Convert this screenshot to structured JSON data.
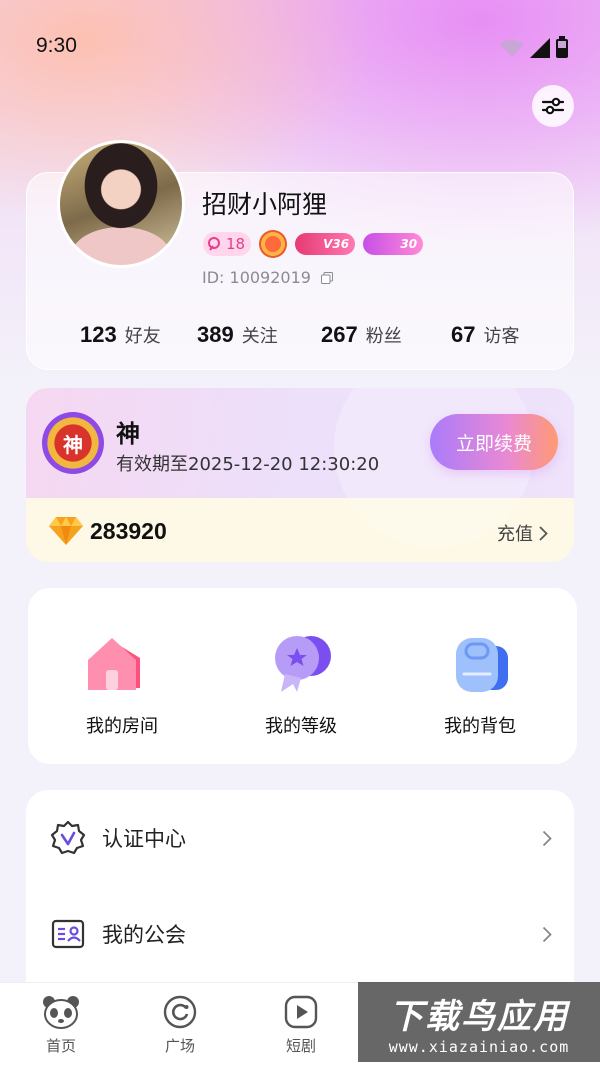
{
  "status_bar": {
    "time": "9:30"
  },
  "profile": {
    "username": "招财小阿狸",
    "charm_level": "18",
    "badge_v36": "V36",
    "badge_30": "30",
    "id_text": "ID: 10092019",
    "stats": [
      {
        "num": "123",
        "label": "好友"
      },
      {
        "num": "389",
        "label": "关注"
      },
      {
        "num": "267",
        "label": "粉丝"
      },
      {
        "num": "67",
        "label": "访客"
      }
    ]
  },
  "vip": {
    "emblem_text": "神",
    "title": "神",
    "expiry": "有效期至2025-12-20 12:30:20",
    "renew_label": "立即续费",
    "diamonds": "283920",
    "recharge_label": "充值"
  },
  "quick_links": [
    {
      "label": "我的房间",
      "icon": "house-icon"
    },
    {
      "label": "我的等级",
      "icon": "level-medal-icon"
    },
    {
      "label": "我的背包",
      "icon": "backpack-icon"
    }
  ],
  "menu": [
    {
      "label": "认证中心",
      "icon": "verify-badge-icon"
    },
    {
      "label": "我的公会",
      "icon": "guild-card-icon"
    }
  ],
  "tabbar": [
    {
      "label": "首页",
      "icon": "panda-icon"
    },
    {
      "label": "广场",
      "icon": "refresh-circle-icon"
    },
    {
      "label": "短剧",
      "icon": "play-icon"
    }
  ],
  "watermark": {
    "title": "下载鸟应用",
    "subtitle": "www.xiazainiao.com"
  },
  "colors": {
    "renew_gradient_start": "#a97bfb",
    "renew_gradient_end": "#ff9a74",
    "charm_pink": "#e43f8e",
    "accent_purple": "#6b4be0"
  }
}
